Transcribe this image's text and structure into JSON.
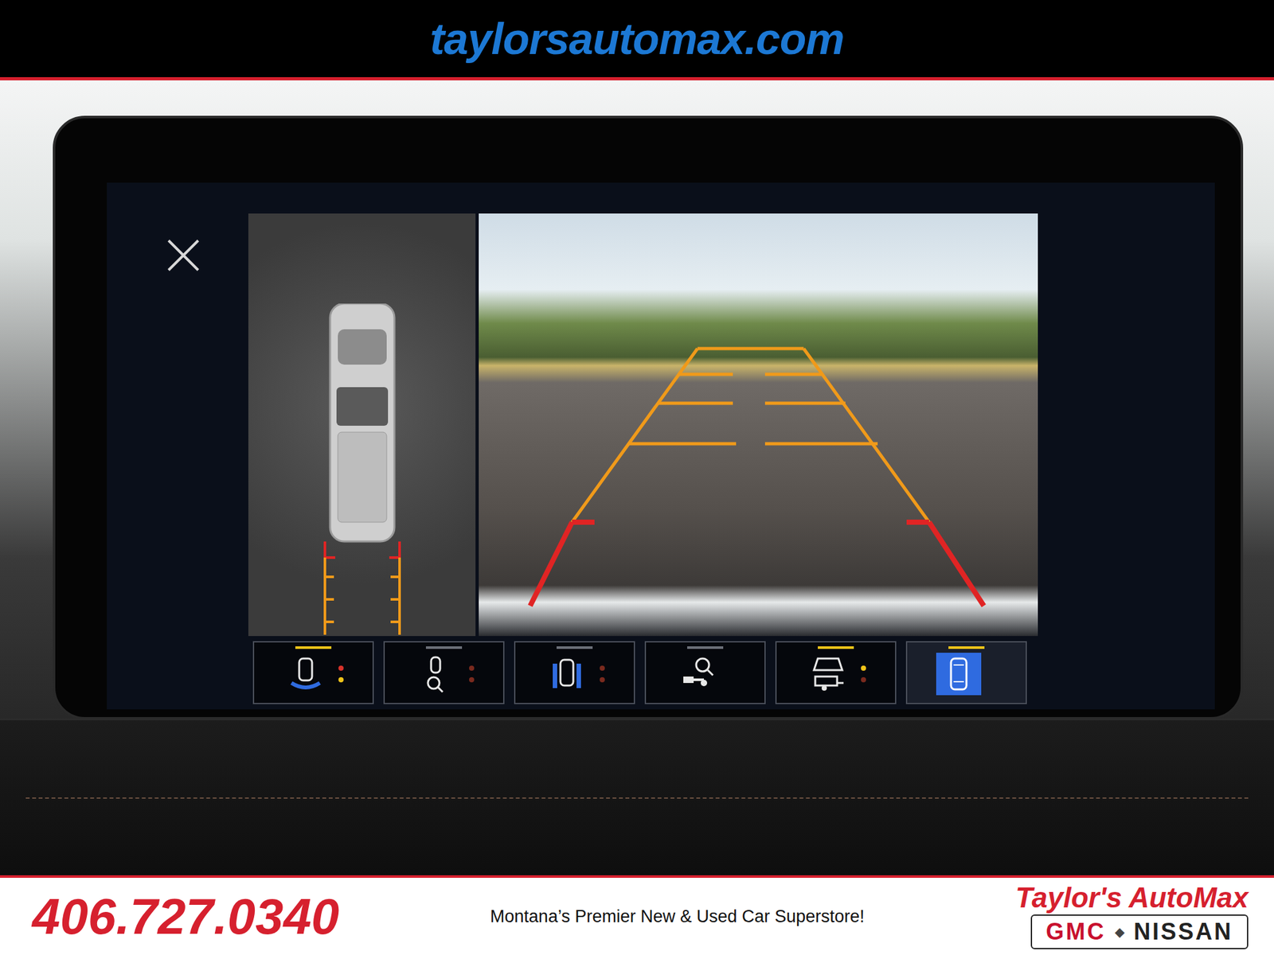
{
  "site": {
    "url": "taylorsautomax.com"
  },
  "view_buttons": [
    {
      "kind": "front-rear",
      "selected": false,
      "active": true,
      "dots": [
        "#d8322a",
        "#f0c419"
      ]
    },
    {
      "kind": "zoom-car",
      "selected": false,
      "active": false,
      "dots": [
        "#7a2a1e",
        "#7a2a1e"
      ]
    },
    {
      "kind": "side-view",
      "selected": false,
      "active": false,
      "dots": [
        "#7a2a1e",
        "#7a2a1e"
      ]
    },
    {
      "kind": "hitch-zoom",
      "selected": false,
      "active": false,
      "dots": []
    },
    {
      "kind": "trailer",
      "selected": false,
      "active": true,
      "dots": [
        "#f0c419",
        "#7a2a1e"
      ]
    },
    {
      "kind": "top-view",
      "selected": true,
      "active": true,
      "dots": []
    }
  ],
  "footer": {
    "phone": "406.727.0340",
    "tagline": "Montana’s Premier New & Used Car Superstore!",
    "dealer": "Taylor's AutoMax",
    "brands": [
      "GMC",
      "NISSAN"
    ],
    "separator": "◆"
  }
}
